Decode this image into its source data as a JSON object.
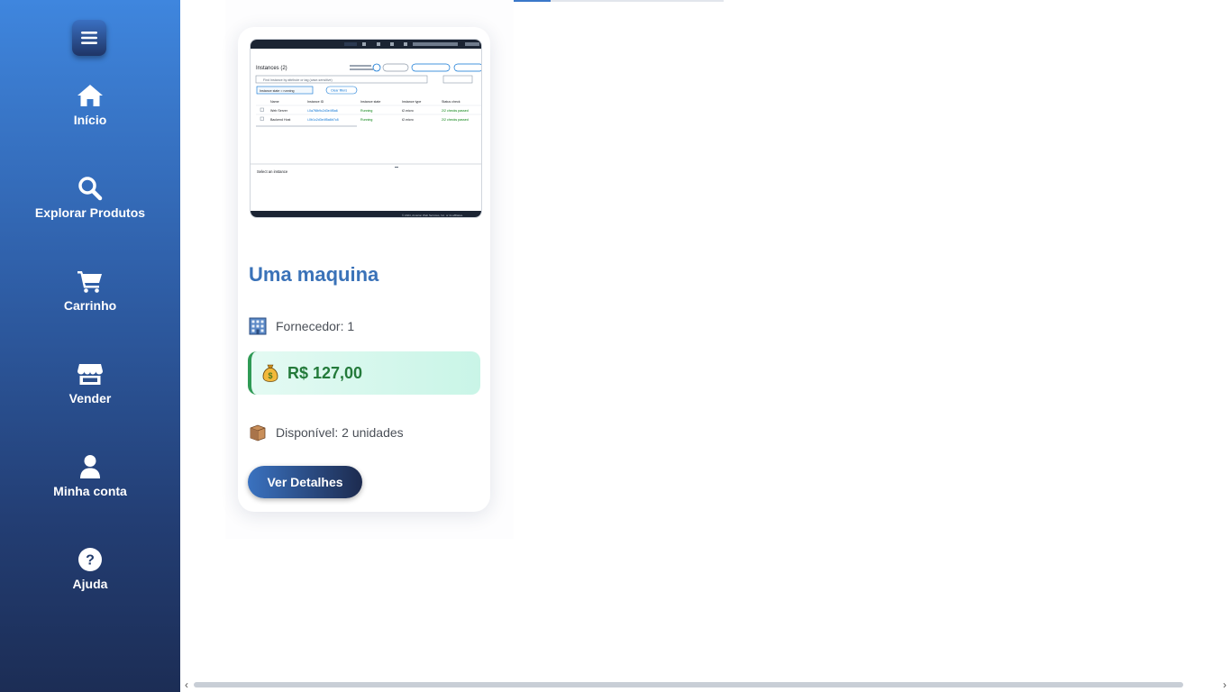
{
  "sidebar": {
    "items": [
      {
        "label": "Início",
        "icon": "home-icon"
      },
      {
        "label": "Explorar Produtos",
        "icon": "search-icon"
      },
      {
        "label": "Carrinho",
        "icon": "cart-icon"
      },
      {
        "label": "Vender",
        "icon": "store-icon"
      },
      {
        "label": "Minha conta",
        "icon": "user-icon"
      },
      {
        "label": "Ajuda",
        "icon": "question-icon"
      }
    ]
  },
  "product": {
    "title": "Uma maquina",
    "supplier": "Fornecedor: 1",
    "supplier_icon": "building-icon",
    "price": "R$ 127,00",
    "price_icon": "money-bag-icon",
    "stock": "Disponível: 2 unidades",
    "stock_icon": "package-icon",
    "details_label": "Ver Detalhes",
    "thumbnail": {
      "heading": "Instances (2)",
      "search_placeholder": "Find Instance by attribute or tag (case-sensitive)",
      "filter_chip": "Instance state = running",
      "clear_filters": "Clear filters",
      "columns": [
        "Name",
        "Instance ID",
        "Instance state",
        "Instance type",
        "Status check"
      ],
      "rows": [
        [
          "Web Server",
          "i-0a7f8b9c2d3e4f5a6",
          "Running",
          "t2.micro",
          "2/2 checks passed"
        ],
        [
          "Backend Host",
          "i-0b1c2d3e4f5a6b7c8",
          "Running",
          "t2.micro",
          "2/2 checks passed"
        ]
      ],
      "select_text": "Select an instance",
      "footer": "© 2024, Amazon Web Services, Inc. or its affiliates."
    }
  },
  "colors": {
    "sidebar_top": "#3f86de",
    "sidebar_bottom": "#1c2d55",
    "title": "#3a72b8",
    "price_text": "#237a3a",
    "price_border": "#2f9a55"
  }
}
